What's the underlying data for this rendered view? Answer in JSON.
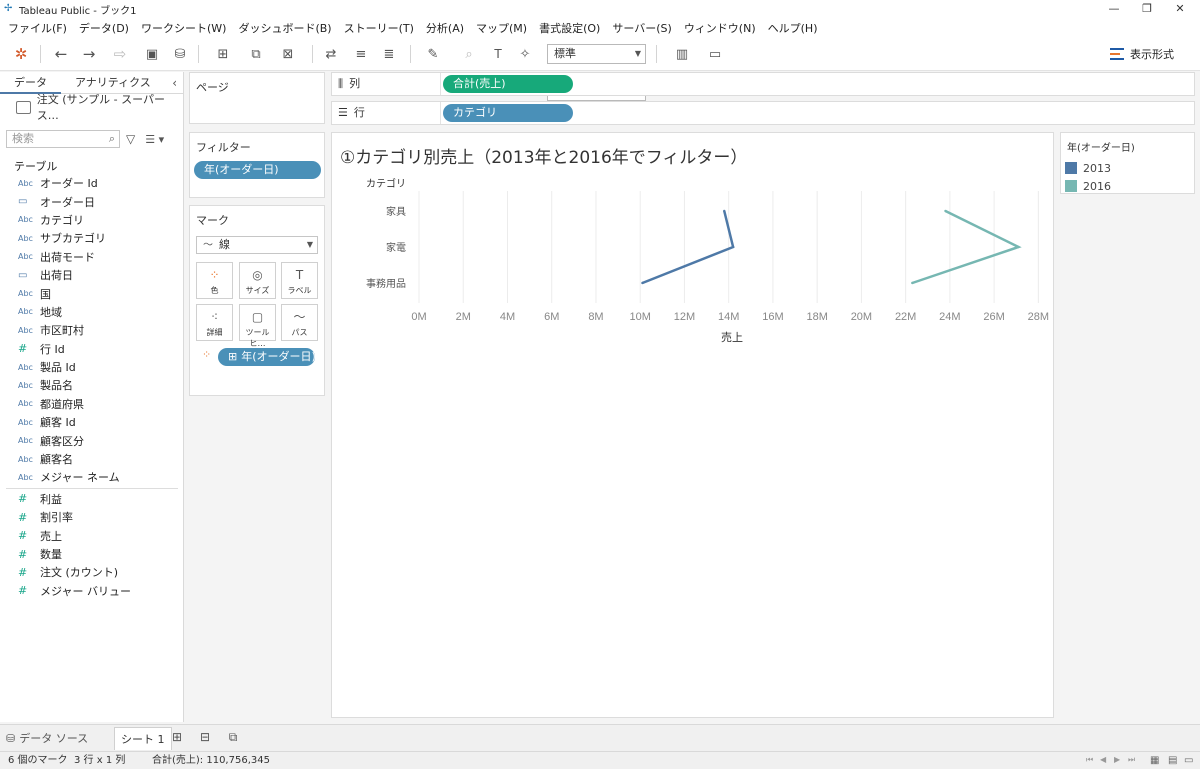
{
  "window": {
    "title": "Tableau Public - ブック1"
  },
  "menu": [
    "ファイル(F)",
    "データ(D)",
    "ワークシート(W)",
    "ダッシュボード(B)",
    "ストーリー(T)",
    "分析(A)",
    "マップ(M)",
    "書式設定(O)",
    "サーバー(S)",
    "ウィンドウ(N)",
    "ヘルプ(H)"
  ],
  "toolbar": {
    "fit_value": "標準",
    "show_me_label": "表示形式"
  },
  "data_pane": {
    "tabs": [
      "データ",
      "アナリティクス"
    ],
    "datasource": "注文 (サンプル - スーパース…",
    "search_placeholder": "検索",
    "section": "テーブル",
    "dimensions": [
      {
        "type": "abc",
        "name": "オーダー Id"
      },
      {
        "type": "date",
        "name": "オーダー日"
      },
      {
        "type": "abc",
        "name": "カテゴリ"
      },
      {
        "type": "abc",
        "name": "サブカテゴリ"
      },
      {
        "type": "abc",
        "name": "出荷モード"
      },
      {
        "type": "date",
        "name": "出荷日"
      },
      {
        "type": "abc",
        "name": "国"
      },
      {
        "type": "abc",
        "name": "地域"
      },
      {
        "type": "abc",
        "name": "市区町村"
      },
      {
        "type": "num",
        "name": "行 Id"
      },
      {
        "type": "abc",
        "name": "製品 Id"
      },
      {
        "type": "abc",
        "name": "製品名"
      },
      {
        "type": "abc",
        "name": "都道府県"
      },
      {
        "type": "abc",
        "name": "顧客 Id"
      },
      {
        "type": "abc",
        "name": "顧客区分"
      },
      {
        "type": "abc",
        "name": "顧客名"
      },
      {
        "type": "abc",
        "name": "メジャー ネーム"
      }
    ],
    "measures": [
      {
        "type": "num",
        "name": "利益"
      },
      {
        "type": "num",
        "name": "割引率"
      },
      {
        "type": "num",
        "name": "売上"
      },
      {
        "type": "num",
        "name": "数量"
      },
      {
        "type": "num",
        "name": "注文 (カウント)"
      },
      {
        "type": "num",
        "name": "メジャー バリュー"
      }
    ],
    "type_labels": {
      "abc": "Abc",
      "date": "▭",
      "num": "#"
    }
  },
  "cards": {
    "pages_title": "ページ",
    "filters_title": "フィルター",
    "filter_pill": "年(オーダー日)",
    "marks_title": "マーク",
    "mark_type": "線",
    "mark_buttons": [
      "色",
      "サイズ",
      "ラベル",
      "詳細",
      "ツールヒ…",
      "パス"
    ],
    "mark_pill": "年(オーダー日)"
  },
  "shelves": {
    "columns_label": "列",
    "columns_pill": "合計(売上)",
    "rows_label": "行",
    "rows_pill": "カテゴリ"
  },
  "viz": {
    "title": "①カテゴリ別売上（2013年と2016年でフィルター）"
  },
  "chart_data": {
    "type": "line",
    "title": "①カテゴリ別売上（2013年と2016年でフィルター）",
    "xlabel": "売上",
    "ylabel": "カテゴリ",
    "categories": [
      "家具",
      "家電",
      "事務用品"
    ],
    "x_ticks": [
      "0M",
      "2M",
      "4M",
      "6M",
      "8M",
      "10M",
      "12M",
      "14M",
      "16M",
      "18M",
      "20M",
      "22M",
      "24M",
      "26M",
      "28M"
    ],
    "xlim": [
      0,
      28.3
    ],
    "x_unit": "M",
    "grid": true,
    "legend_title": "年(オーダー日)",
    "legend_position": "right",
    "series": [
      {
        "name": "2013",
        "color": "#4e79a7",
        "values": [
          13.8,
          14.2,
          10.1
        ]
      },
      {
        "name": "2016",
        "color": "#76b7b2",
        "values": [
          23.8,
          27.1,
          22.3
        ]
      }
    ]
  },
  "tabs": {
    "datasource": "データ ソース",
    "sheet": "シート 1"
  },
  "status": {
    "marks": "6 個のマーク",
    "rows_cols": "3 行 x 1 列",
    "sum": "合計(売上): 110,756,345"
  }
}
